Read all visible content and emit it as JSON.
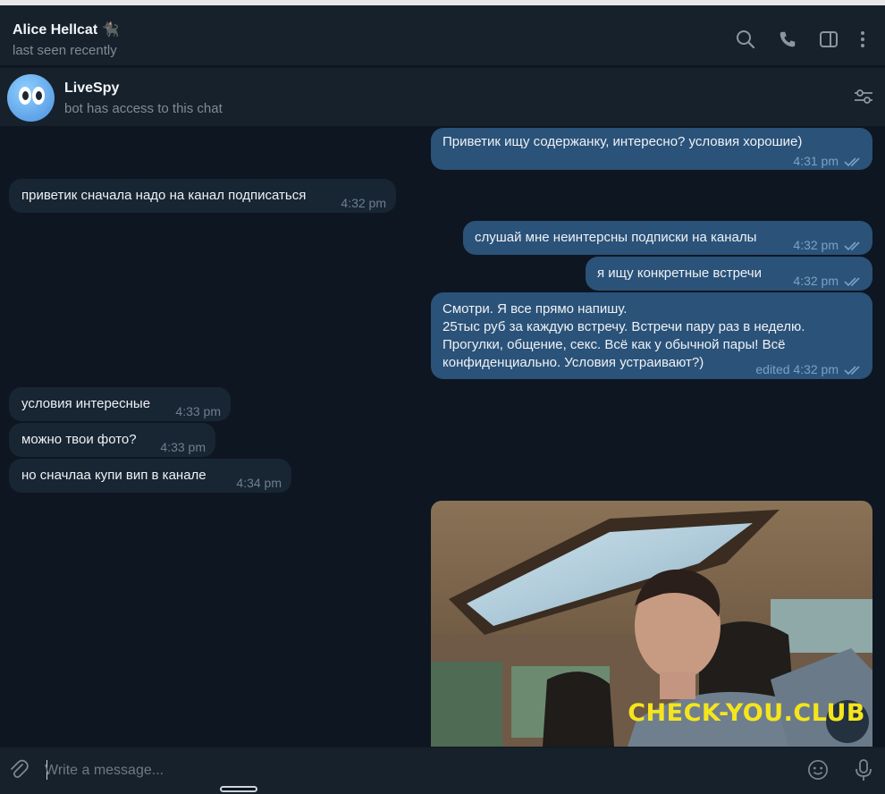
{
  "header": {
    "name": "Alice Hellcat",
    "name_emoji": "🐈‍⬛",
    "status": "last seen recently",
    "icons": [
      "search-icon",
      "phone-icon",
      "sidebar-toggle-icon",
      "more-vertical-icon"
    ]
  },
  "bot": {
    "name": "LiveSpy",
    "subtitle": "bot has access to this chat",
    "settings_icon": "sliders-icon"
  },
  "messages": [
    {
      "dir": "out",
      "text": "Приветик ищу содержанку, интересно? условия хорошие)",
      "time": "4:31 pm"
    },
    {
      "dir": "in",
      "text": "приветик сначала надо на канал подписаться",
      "time": "4:32 pm"
    },
    {
      "dir": "out",
      "text": "слушай мне неинтерсны подписки на каналы",
      "time": "4:32 pm"
    },
    {
      "dir": "out",
      "text": "я ищу конкретные встречи",
      "time": "4:32 pm"
    },
    {
      "dir": "out",
      "text": "Смотри. Я все прямо напишу.\n25тыс руб за каждую встречу. Встречи пару раз в неделю.\nПрогулки, общение, секс. Всё как у обычной пары! Всё\nконфиденциально. Условия устраивают?)",
      "time": "edited 4:32 pm"
    },
    {
      "dir": "in",
      "text": "условия интересные",
      "time": "4:33 pm"
    },
    {
      "dir": "in",
      "text": "можно твои фото?",
      "time": "4:33 pm"
    },
    {
      "dir": "in",
      "text": "но сначлаа купи вип в канале",
      "time": "4:34 pm"
    }
  ],
  "photo_watermark": "CHECK-YOU.CLUB",
  "composer": {
    "placeholder": "Write a message...",
    "icons": [
      "attach-icon",
      "emoji-icon",
      "microphone-icon"
    ]
  },
  "colors": {
    "background": "#0e1621",
    "panel": "#17212b",
    "incoming": "#182533",
    "outgoing": "#2b5278",
    "watermark": "#f5e51c"
  }
}
